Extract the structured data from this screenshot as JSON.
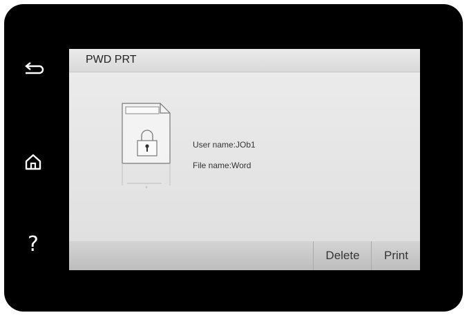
{
  "sidebar": {
    "back_icon": "back-arrow-icon",
    "home_icon": "home-icon",
    "help_label": "?"
  },
  "header": {
    "title": "PWD PRT"
  },
  "job": {
    "icon": "locked-document-icon",
    "user_line": "User name:JOb1",
    "file_line": "File name:Word"
  },
  "actions": {
    "delete_label": "Delete",
    "print_label": "Print"
  }
}
